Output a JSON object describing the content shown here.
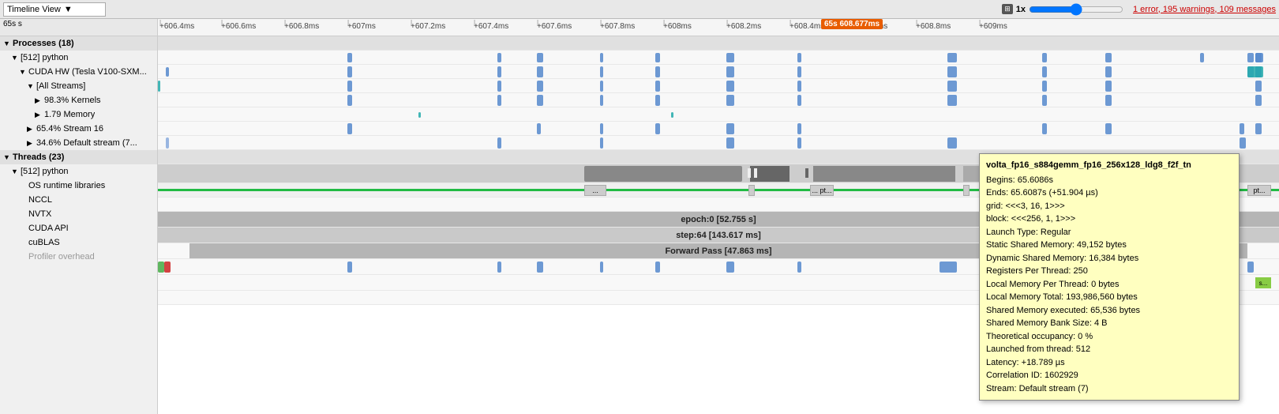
{
  "toolbar": {
    "view_label": "Timeline View",
    "zoom_icon": "⊞",
    "zoom_multiplier": "1x",
    "error_text": "1 error, 195 warnings, 109 messages"
  },
  "ruler": {
    "left_label": "65s  s",
    "ticks": [
      "+606.4ms",
      "+606.6ms",
      "+606.8ms",
      "+607ms",
      "+607.2ms",
      "+607.4ms",
      "+607.6ms",
      "+607.8ms",
      "+608ms",
      "+608.2ms",
      "+608.4ms",
      "+608.6ms",
      "+608.8ms",
      "+609ms"
    ],
    "cursor_label": "65s 608.677ms"
  },
  "tree": {
    "items": [
      {
        "label": "Processes (18)",
        "depth": 0,
        "toggle": "▼",
        "bold": true
      },
      {
        "label": "[512] python",
        "depth": 1,
        "toggle": "▼"
      },
      {
        "label": "CUDA HW (Tesla V100-SXM...",
        "depth": 2,
        "toggle": "▼"
      },
      {
        "label": "[All Streams]",
        "depth": 3,
        "toggle": "▼"
      },
      {
        "label": "98.3% Kernels",
        "depth": 4,
        "toggle": "▶"
      },
      {
        "label": "1.79 Memory",
        "depth": 4,
        "toggle": "▶"
      },
      {
        "label": "65.4% Stream 16",
        "depth": 4,
        "toggle": "▶"
      },
      {
        "label": "34.6% Default stream (7...",
        "depth": 4,
        "toggle": "▶"
      },
      {
        "label": "Threads (23)",
        "depth": 0,
        "toggle": "▼",
        "bold": true
      },
      {
        "label": "[512] python",
        "depth": 1,
        "toggle": "▼"
      },
      {
        "label": "OS runtime libraries",
        "depth": 2,
        "toggle": ""
      },
      {
        "label": "NCCL",
        "depth": 2,
        "toggle": ""
      },
      {
        "label": "NVTX",
        "depth": 2,
        "toggle": ""
      },
      {
        "label": "CUDA API",
        "depth": 2,
        "toggle": ""
      },
      {
        "label": "cuBLAS",
        "depth": 2,
        "toggle": ""
      },
      {
        "label": "Profiler overhead",
        "depth": 2,
        "toggle": ""
      }
    ]
  },
  "tooltip": {
    "title": "volta_fp16_s884gemm_fp16_256x128_ldg8_f2f_tn",
    "begins": "Begins: 65.6086s",
    "ends": "Ends: 65.6087s (+51.904 µs)",
    "grid": "grid:  <<<3, 16, 1>>>",
    "block": "block: <<<256, 1, 1>>>",
    "launch_type": "Launch Type: Regular",
    "static_shared": "Static Shared Memory: 49,152 bytes",
    "dynamic_shared": "Dynamic Shared Memory: 16,384 bytes",
    "registers": "Registers Per Thread: 250",
    "local_per_thread": "Local Memory Per Thread: 0 bytes",
    "local_total": "Local Memory Total: 193,986,560 bytes",
    "shared_exec": "Shared Memory executed: 65,536 bytes",
    "shared_bank": "Shared Memory Bank Size: 4 B",
    "occupancy": "Theoretical occupancy: 0 %",
    "launched_from": "Launched from thread: 512",
    "latency": "Latency: +18.789 µs",
    "correlation": "Correlation ID: 1602929",
    "stream": "Stream: Default stream (7)"
  },
  "colors": {
    "accent_blue": "#5588cc",
    "accent_green": "#22bb44",
    "accent_gray": "#888888",
    "tooltip_bg": "#ffffc0",
    "ruler_cursor": "#e85c00"
  }
}
